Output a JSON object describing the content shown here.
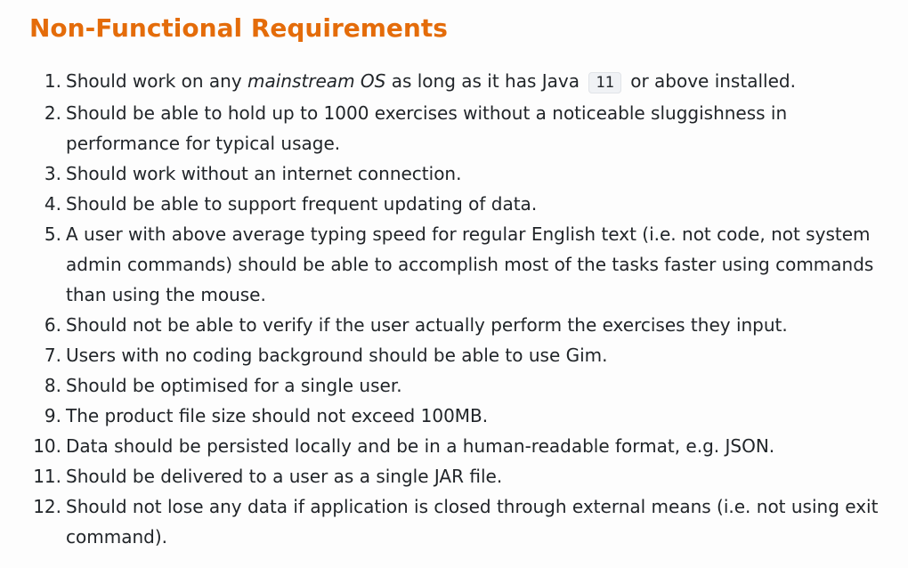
{
  "heading": "Non-Functional Requirements",
  "requirements": [
    {
      "number": "1.",
      "part1": "Should work on any ",
      "emphasis": "mainstream OS",
      "part2": " as long as it has Java ",
      "code": "11",
      "part3": " or above installed."
    },
    {
      "number": "2.",
      "text": "Should be able to hold up to 1000 exercises without a noticeable sluggishness in performance for typical usage."
    },
    {
      "number": "3.",
      "text": "Should work without an internet connection."
    },
    {
      "number": "4.",
      "text": "Should be able to support frequent updating of data."
    },
    {
      "number": "5.",
      "text": "A user with above average typing speed for regular English text (i.e. not code, not system admin commands) should be able to accomplish most of the tasks faster using commands than using the mouse."
    },
    {
      "number": "6.",
      "text": "Should not be able to verify if the user actually perform the exercises they input."
    },
    {
      "number": "7.",
      "text": "Users with no coding background should be able to use Gim."
    },
    {
      "number": "8.",
      "text": "Should be optimised for a single user."
    },
    {
      "number": "9.",
      "text": "The product file size should not exceed 100MB."
    },
    {
      "number": "10.",
      "text": "Data should be persisted locally and be in a human-readable format, e.g. JSON."
    },
    {
      "number": "11.",
      "text": "Should be delivered to a user as a single JAR file."
    },
    {
      "number": "12.",
      "text": "Should not lose any data if application is closed through external means (i.e. not using exit command)."
    }
  ]
}
